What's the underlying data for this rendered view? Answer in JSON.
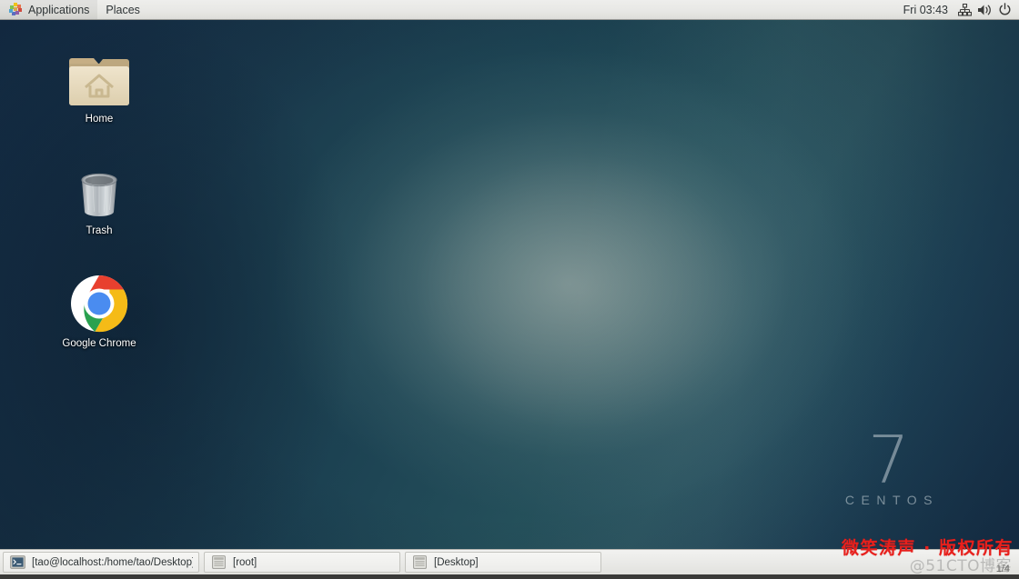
{
  "top_panel": {
    "applications_label": "Applications",
    "places_label": "Places",
    "clock": "Fri 03:43",
    "tray": [
      {
        "name": "network-icon",
        "label": "Network"
      },
      {
        "name": "volume-icon",
        "label": "Volume"
      },
      {
        "name": "power-icon",
        "label": "Power"
      }
    ]
  },
  "desktop": {
    "icons": [
      {
        "name": "home-folder-icon",
        "label": "Home"
      },
      {
        "name": "trash-icon",
        "label": "Trash"
      },
      {
        "name": "google-chrome-icon",
        "label": "Google Chrome"
      }
    ],
    "watermark": {
      "version": "7",
      "distro": "CENTOS"
    }
  },
  "taskbar": {
    "buttons": [
      {
        "icon": "terminal-icon",
        "label": "[tao@localhost:/home/tao/Desktop]"
      },
      {
        "icon": "window-icon",
        "label": "[root]"
      },
      {
        "icon": "window-icon",
        "label": "[Desktop]"
      }
    ]
  },
  "overlay": {
    "watermark_red": "微笑涛声 · 版权所有",
    "watermark_gray": "@51CTO博客",
    "page_indicator": "1/4"
  },
  "colors": {
    "panel_bg": "#e8e8e5",
    "desktop_dark": "#16304a",
    "desktop_teal": "#2b5560",
    "accent_red": "#e8201c",
    "taskbar_bg": "#eaeae7"
  }
}
